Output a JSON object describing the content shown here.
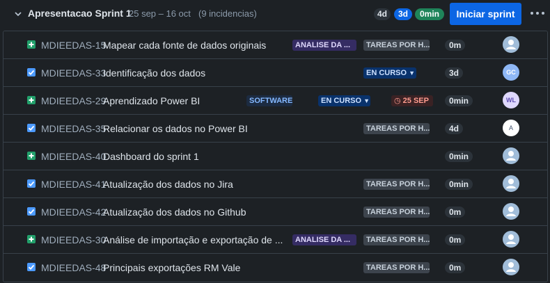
{
  "sprint": {
    "name": "Apresentacao Sprint 1",
    "dates": "25 sep – 16 oct",
    "count": "(9 incidencias)",
    "todo_points": "4d",
    "progress_points": "3d",
    "done_points": "0min",
    "start_label": "Iniciar sprint"
  },
  "issues": [
    {
      "type_icon": "story-icon",
      "key": "MDIEEDAS-15",
      "summary": "Mapear cada fonte de dados originais",
      "epic": "ANALISE DA ...",
      "status": "TAREAS POR H...",
      "estimate": "0m",
      "avatar": "person-icon"
    },
    {
      "type_icon": "task-icon",
      "key": "MDIEEDAS-33",
      "summary": "Identificação dos dados",
      "status": "EN CURSO",
      "estimate": "3d",
      "avatar": "GC"
    },
    {
      "type_icon": "story-icon",
      "key": "MDIEEDAS-29",
      "summary": "Aprendizado Power BI",
      "label": "SOFTWARE",
      "status": "EN CURSO",
      "due": "25 SEP",
      "estimate": "0min",
      "avatar": "WL"
    },
    {
      "type_icon": "task-icon",
      "key": "MDIEEDAS-35",
      "summary": "Relacionar os dados no Power BI",
      "status": "TAREAS POR H...",
      "estimate": "4d",
      "avatar": "A"
    },
    {
      "type_icon": "story-icon",
      "key": "MDIEEDAS-40",
      "summary": "Dashboard do sprint 1",
      "estimate": "0min",
      "avatar": "person-icon"
    },
    {
      "type_icon": "task-icon",
      "key": "MDIEEDAS-41",
      "summary": "Atualização dos dados no Jira",
      "status": "TAREAS POR H...",
      "estimate": "0min",
      "avatar": "person-icon"
    },
    {
      "type_icon": "task-icon",
      "key": "MDIEEDAS-42",
      "summary": "Atualização dos dados no Github",
      "status": "TAREAS POR H...",
      "estimate": "0m",
      "avatar": "person-icon"
    },
    {
      "type_icon": "story-icon",
      "key": "MDIEEDAS-30",
      "summary": "Análise de importação e exportação de ...",
      "epic": "ANALISE DA ...",
      "status": "TAREAS POR H...",
      "estimate": "0m",
      "avatar": "person-icon"
    },
    {
      "type_icon": "task-icon",
      "key": "MDIEEDAS-48",
      "summary": "Principais exportações RM Vale",
      "status": "TAREAS POR H...",
      "estimate": "0m",
      "avatar": "person-icon"
    }
  ]
}
